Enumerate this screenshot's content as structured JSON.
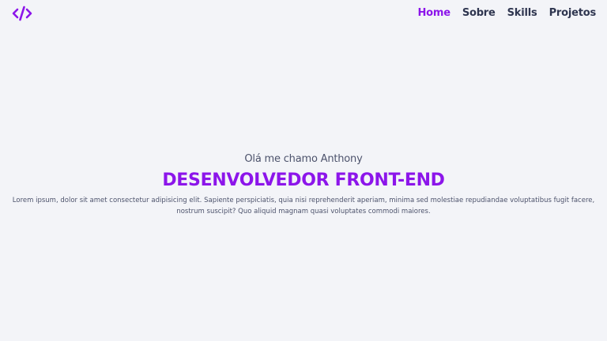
{
  "logo": {
    "icon": "code-brackets-icon",
    "color": "#8c15ea"
  },
  "nav": {
    "items": [
      {
        "label": "Home",
        "active": true
      },
      {
        "label": "Sobre",
        "active": false
      },
      {
        "label": "Skills",
        "active": false
      },
      {
        "label": "Projetos",
        "active": false
      }
    ]
  },
  "hero": {
    "greeting": "Olá me chamo Anthony",
    "role": "DESENVOLVEDOR FRONT-END",
    "bio": "Lorem ipsum, dolor sit amet consectetur adipisicing elit. Sapiente perspiciatis, quia nisi reprehenderit aperiam, minima sed molestiae repudiandae voluptatibus fugit facere, nostrum suscipit? Quo aliquid magnam quasi voluptates commodi maiores."
  },
  "colors": {
    "accent": "#8c15ea",
    "text": "#2f3650",
    "background": "#f3f4f8"
  }
}
